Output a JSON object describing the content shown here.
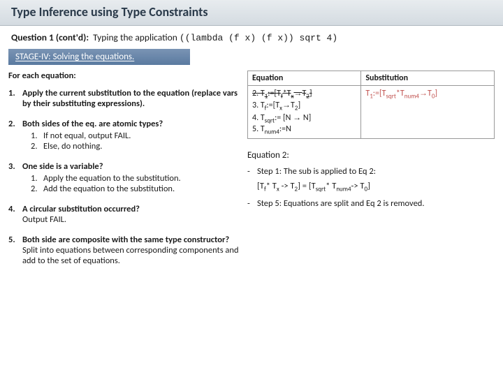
{
  "title": "Type Inference using Type Constraints",
  "question_label": "Question 1 (cont'd):",
  "question_text": "Typing the application",
  "question_code": "((lambda (f x) (f x)) sqrt 4)",
  "stage_label": "STAGE-IV: Solving the equations.",
  "left": {
    "for_each": "For each equation:",
    "steps": [
      {
        "n": "1.",
        "text": "Apply the current substitution to the equation (replace vars by their substituting expressions)."
      },
      {
        "n": "2.",
        "q": "Both sides of the eq. are atomic types?",
        "inner": [
          {
            "n": "1.",
            "t": "If not equal, output FAIL."
          },
          {
            "n": "2.",
            "t": "Else, do nothing."
          }
        ]
      },
      {
        "n": "3.",
        "q": "One side is a variable?",
        "inner": [
          {
            "n": "1.",
            "t": "Apply the equation to the substitution."
          },
          {
            "n": "2.",
            "t": "Add the equation to the substitution."
          }
        ]
      },
      {
        "n": "4.",
        "q": "A circular substitution occurred?",
        "tail": "Output FAIL."
      },
      {
        "n": "5.",
        "q": "Both side are composite with the same type constructor?",
        "tail": "Split into equations between corresponding components and add to the set of equations."
      }
    ]
  },
  "table": {
    "h1": "Equation",
    "h2": "Substitution",
    "r2a": "2. T",
    "r2b": ":=[T",
    "r2c": "*T",
    "r2d": "T",
    "r2e": "]",
    "r3": "3. T",
    "r3b": ":=[T",
    "r3c": "T",
    "r3d": "]",
    "r4": "4. T",
    "r4b": ":= [N",
    "r4c": "N]",
    "r5": "5. T",
    "r5b": ":=N",
    "sub_a": "T",
    "sub_b": ":=[T",
    "sub_c": "*T",
    "sub_d": "T",
    "sub_e": "]",
    "i_1": "1",
    "i_f": "f",
    "i_x": "x",
    "i_2": "2",
    "i_sqrt": "sqrt",
    "i_num4": "num4",
    "i_0": "0"
  },
  "eq2": {
    "title": "Equation 2:",
    "s1": "Step 1: The sub is applied to Eq 2:",
    "expr_a": "[T",
    "expr_b": "* T",
    "expr_c": " -> T",
    "expr_d": "] = [T",
    "expr_e": "* T",
    "expr_f": "-> T",
    "expr_g": "]",
    "s5": "Step 5: Equations are split and Eq 2 is removed."
  }
}
